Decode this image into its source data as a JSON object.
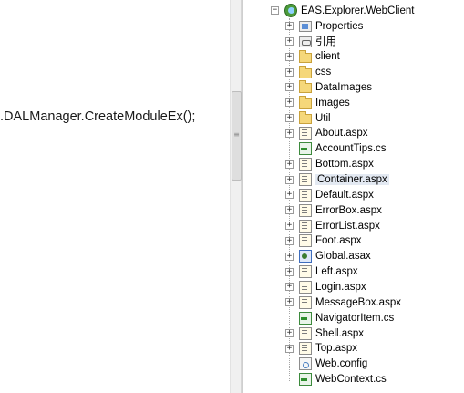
{
  "editor": {
    "code_line": ".DALManager.CreateModuleEx();"
  },
  "scrollbar": {
    "grip": "≡"
  },
  "explorer": {
    "project": {
      "name": "EAS.Explorer.WebClient",
      "expander": "−",
      "icon": "project-icon"
    },
    "items": [
      {
        "label": "Properties",
        "icon": "properties-icon",
        "expander": "+"
      },
      {
        "label": "引用",
        "icon": "references-icon",
        "expander": "+"
      },
      {
        "label": "client",
        "icon": "folder-icon",
        "expander": "+"
      },
      {
        "label": "css",
        "icon": "folder-icon",
        "expander": "+"
      },
      {
        "label": "DataImages",
        "icon": "folder-icon",
        "expander": "+"
      },
      {
        "label": "Images",
        "icon": "folder-icon",
        "expander": "+"
      },
      {
        "label": "Util",
        "icon": "folder-icon",
        "expander": "+"
      },
      {
        "label": "About.aspx",
        "icon": "aspx-page-icon",
        "expander": "+"
      },
      {
        "label": "AccountTips.cs",
        "icon": "csharp-file-icon",
        "expander": ""
      },
      {
        "label": "Bottom.aspx",
        "icon": "aspx-page-icon",
        "expander": "+"
      },
      {
        "label": "Container.aspx",
        "icon": "aspx-page-icon",
        "expander": "+"
      },
      {
        "label": "Default.aspx",
        "icon": "aspx-page-icon",
        "expander": "+"
      },
      {
        "label": "ErrorBox.aspx",
        "icon": "aspx-page-icon",
        "expander": "+"
      },
      {
        "label": "ErrorList.aspx",
        "icon": "aspx-page-icon",
        "expander": "+"
      },
      {
        "label": "Foot.aspx",
        "icon": "aspx-page-icon",
        "expander": "+"
      },
      {
        "label": "Global.asax",
        "icon": "asax-file-icon",
        "expander": "+"
      },
      {
        "label": "Left.aspx",
        "icon": "aspx-page-icon",
        "expander": "+"
      },
      {
        "label": "Login.aspx",
        "icon": "aspx-page-icon",
        "expander": "+"
      },
      {
        "label": "MessageBox.aspx",
        "icon": "aspx-page-icon",
        "expander": "+"
      },
      {
        "label": "NavigatorItem.cs",
        "icon": "csharp-file-icon",
        "expander": ""
      },
      {
        "label": "Shell.aspx",
        "icon": "aspx-page-icon",
        "expander": "+"
      },
      {
        "label": "Top.aspx",
        "icon": "aspx-page-icon",
        "expander": "+"
      },
      {
        "label": "Web.config",
        "icon": "config-file-icon",
        "expander": ""
      },
      {
        "label": "WebContext.cs",
        "icon": "csharp-file-icon",
        "expander": ""
      }
    ]
  }
}
